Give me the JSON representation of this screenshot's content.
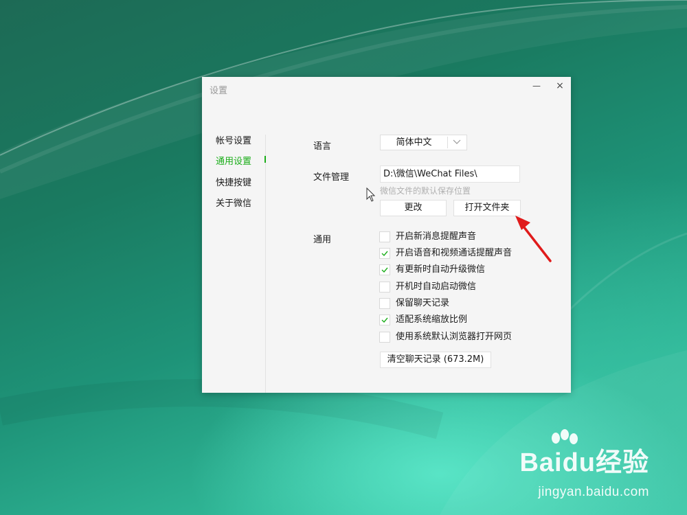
{
  "window": {
    "title": "设置",
    "minimize_glyph": "—",
    "close_glyph": "×"
  },
  "sidebar": {
    "items": [
      {
        "label": "帐号设置",
        "active": false
      },
      {
        "label": "通用设置",
        "active": true
      },
      {
        "label": "快捷按键",
        "active": false
      },
      {
        "label": "关于微信",
        "active": false
      }
    ]
  },
  "language": {
    "label": "语言",
    "selected": "简体中文"
  },
  "file_management": {
    "label": "文件管理",
    "path": "D:\\微信\\WeChat Files\\",
    "hint": "微信文件的默认保存位置",
    "change_button": "更改",
    "open_folder_button": "打开文件夹"
  },
  "general": {
    "label": "通用",
    "options": [
      {
        "label": "开启新消息提醒声音",
        "checked": false
      },
      {
        "label": "开启语音和视频通话提醒声音",
        "checked": true
      },
      {
        "label": "有更新时自动升级微信",
        "checked": true
      },
      {
        "label": "开机时自动启动微信",
        "checked": false
      },
      {
        "label": "保留聊天记录",
        "checked": false
      },
      {
        "label": "适配系统缩放比例",
        "checked": true
      },
      {
        "label": "使用系统默认浏览器打开网页",
        "checked": false
      }
    ],
    "clear_history_button": "清空聊天记录 (673.2M)"
  },
  "watermark": {
    "brand": "Baidu经验",
    "url": "jingyan.baidu.com"
  },
  "colors": {
    "accent_green": "#1aad19",
    "annotation_red": "#e01b1b"
  },
  "icons": {
    "minimize": "minimize-icon",
    "close": "close-icon",
    "dropdown": "chevron-down-icon",
    "check": "checkmark-icon",
    "cursor": "mouse-cursor-icon",
    "arrow": "red-arrow-annotation"
  }
}
